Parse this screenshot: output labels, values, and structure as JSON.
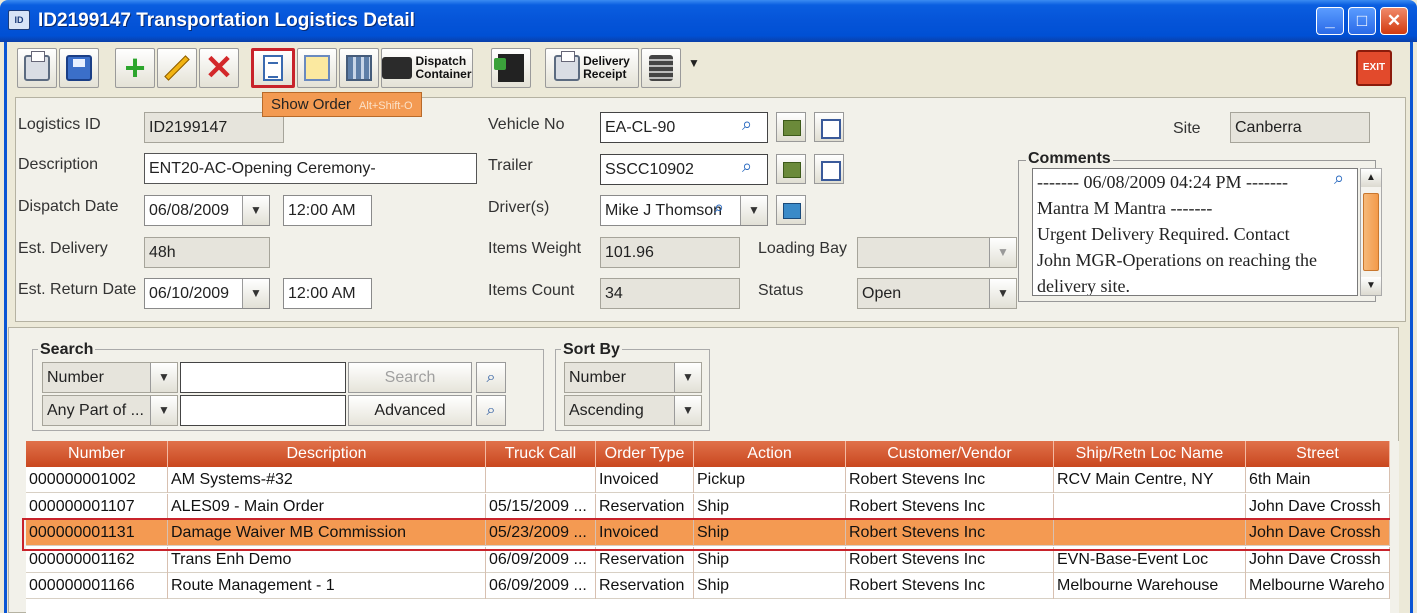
{
  "window": {
    "title": "ID2199147 Transportation Logistics Detail",
    "app_icon_text": "ID"
  },
  "toolbar": {
    "dispatch_label_1": "Dispatch",
    "dispatch_label_2": "Container",
    "delivery_label_1": "Delivery",
    "delivery_label_2": "Receipt",
    "exit_label": "EXIT",
    "tooltip_text": "Show Order",
    "tooltip_accel": "Alt+Shift-O"
  },
  "form": {
    "logistics_id_label": "Logistics ID",
    "logistics_id": "ID2199147",
    "description_label": "Description",
    "description": "ENT20-AC-Opening Ceremony-",
    "dispatch_date_label": "Dispatch Date",
    "dispatch_date": "06/08/2009",
    "dispatch_time": "12:00 AM",
    "est_delivery_label": "Est. Delivery",
    "est_delivery": "48h",
    "est_return_label": "Est. Return Date",
    "est_return_date": "06/10/2009",
    "est_return_time": "12:00 AM",
    "vehicle_label": "Vehicle No",
    "vehicle": "EA-CL-90",
    "trailer_label": "Trailer",
    "trailer": "SSCC10902",
    "drivers_label": "Driver(s)",
    "drivers": "Mike J Thomson",
    "items_weight_label": "Items Weight",
    "items_weight": "101.96",
    "items_count_label": "Items Count",
    "items_count": "34",
    "loading_bay_label": "Loading Bay",
    "loading_bay": "",
    "status_label": "Status",
    "status": "Open",
    "site_label": "Site",
    "site": "Canberra",
    "comments_label": "Comments",
    "comments_lines": [
      "------- 06/08/2009 04:24 PM -------",
      "Mantra M Mantra -------",
      "Urgent Delivery Required. Contact",
      "John MGR-Operations on reaching the",
      "delivery site."
    ]
  },
  "search": {
    "group_label": "Search",
    "field_select": "Number",
    "match_select": "Any Part of ...",
    "search_value": "",
    "advanced_value": "",
    "search_button": "Search",
    "advanced_button": "Advanced"
  },
  "sort": {
    "group_label": "Sort By",
    "field": "Number",
    "order": "Ascending"
  },
  "table": {
    "columns": [
      "Number",
      "Description",
      "Truck Call",
      "Order Type",
      "Action",
      "Customer/Vendor",
      "Ship/Retn Loc Name",
      "Street"
    ],
    "rows": [
      [
        "000000001002",
        "AM Systems-#32",
        "",
        "Invoiced",
        "Pickup",
        "Robert Stevens Inc",
        "RCV Main Centre, NY",
        "6th Main"
      ],
      [
        "000000001107",
        "ALES09 - Main Order",
        "05/15/2009 ...",
        "Reservation",
        "Ship",
        "Robert Stevens Inc",
        "",
        "John  Dave Crossh"
      ],
      [
        "000000001131",
        "Damage Waiver MB Commission",
        "05/23/2009 ...",
        "Invoiced",
        "Ship",
        "Robert Stevens Inc",
        "",
        "John  Dave Crossh"
      ],
      [
        "000000001162",
        "Trans Enh Demo",
        "06/09/2009 ...",
        "Reservation",
        "Ship",
        "Robert Stevens Inc",
        "EVN-Base-Event Loc",
        "John  Dave Crossh"
      ],
      [
        "000000001166",
        "Route Management - 1",
        "06/09/2009 ...",
        "Reservation",
        "Ship",
        "Robert Stevens Inc",
        "Melbourne Warehouse",
        "Melbourne Wareho"
      ]
    ],
    "selected_row": 2
  },
  "colors": {
    "titlebar": "#0554d8",
    "header": "#c9471f",
    "selected_row": "#f49a52",
    "highlight_border": "#c8232b"
  }
}
